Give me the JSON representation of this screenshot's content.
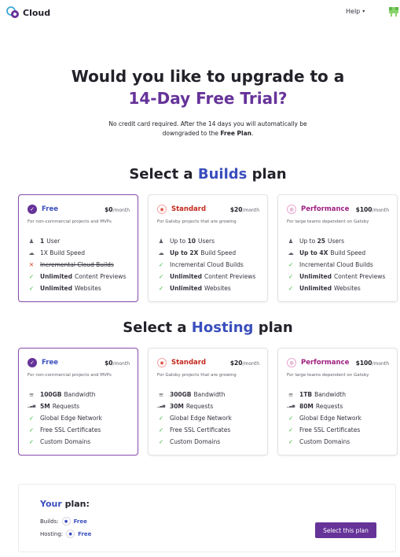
{
  "header": {
    "logo_text": "Cloud",
    "help_label": "Help",
    "help_chevron": "▾"
  },
  "hero": {
    "title": "Would you like to upgrade to a",
    "accent": "14-Day Free Trial?",
    "subtitle_1": "No credit card required. After the 14 days you will automatically be downgraded to the ",
    "subtitle_bold": "Free Plan",
    "subtitle_end": "."
  },
  "builds": {
    "title_pre": "Select a ",
    "title_accent": "Builds",
    "title_post": " plan",
    "plans": [
      {
        "name": "Free",
        "price": "$0",
        "per": "/month",
        "desc": "For non-commercial projects and MVPs",
        "features": [
          {
            "icon": "user-icon",
            "glyph": "♟",
            "bold": "1",
            "text": "User"
          },
          {
            "icon": "cloud-icon",
            "glyph": "☁",
            "bold": "",
            "text": "1X Build Speed"
          },
          {
            "icon": "x-icon",
            "glyph": "✕",
            "bold": "",
            "text": "Incremental Cloud Builds"
          },
          {
            "icon": "check-icon",
            "glyph": "✓",
            "bold": "Unlimited",
            "text": "Content Previews"
          },
          {
            "icon": "check-icon",
            "glyph": "✓",
            "bold": "Unlimited",
            "text": "Websites"
          }
        ]
      },
      {
        "name": "Standard",
        "price": "$20",
        "per": "/month",
        "desc": "For Gatsby projects that are growing",
        "features": [
          {
            "icon": "users-icon",
            "glyph": "♟",
            "bold": "",
            "text": "Up to ",
            "bold2": "10",
            "text2": "Users"
          },
          {
            "icon": "cloud-icon",
            "glyph": "☁",
            "bold": "Up to 2X",
            "text": "Build Speed"
          },
          {
            "icon": "check-icon",
            "glyph": "✓",
            "bold": "",
            "text": "Incremental Cloud Builds"
          },
          {
            "icon": "check-icon",
            "glyph": "✓",
            "bold": "Unlimited",
            "text": "Content Previews"
          },
          {
            "icon": "check-icon",
            "glyph": "✓",
            "bold": "Unlimited",
            "text": "Websites"
          }
        ]
      },
      {
        "name": "Performance",
        "price": "$100",
        "per": "/month",
        "desc": "For large teams dependent on Gatsby",
        "features": [
          {
            "icon": "users-icon",
            "glyph": "♟",
            "bold": "",
            "text": "Up to ",
            "bold2": "25",
            "text2": "Users"
          },
          {
            "icon": "cloud-icon",
            "glyph": "☁",
            "bold": "Up to 4X",
            "text": "Build Speed"
          },
          {
            "icon": "check-icon",
            "glyph": "✓",
            "bold": "",
            "text": "Incremental Cloud Builds"
          },
          {
            "icon": "check-icon",
            "glyph": "✓",
            "bold": "Unlimited",
            "text": "Content Previews"
          },
          {
            "icon": "check-icon",
            "glyph": "✓",
            "bold": "Unlimited",
            "text": "Websites"
          }
        ]
      }
    ]
  },
  "hosting": {
    "title_pre": "Select a ",
    "title_accent": "Hosting",
    "title_post": " plan",
    "plans": [
      {
        "name": "Free",
        "price": "$0",
        "per": "/month",
        "desc": "For non-commercial projects and MVPs",
        "features": [
          {
            "icon": "database-icon",
            "glyph": "≡",
            "bold": "100GB",
            "text": "Bandwidth"
          },
          {
            "icon": "signal-icon",
            "glyph": "▁▃▅",
            "bold": "5M",
            "text": "Requests"
          },
          {
            "icon": "check-icon",
            "glyph": "✓",
            "bold": "",
            "text": "Global Edge Network"
          },
          {
            "icon": "check-icon",
            "glyph": "✓",
            "bold": "",
            "text": "Free SSL Certificates"
          },
          {
            "icon": "check-icon",
            "glyph": "✓",
            "bold": "",
            "text": "Custom Domains"
          }
        ]
      },
      {
        "name": "Standard",
        "price": "$20",
        "per": "/month",
        "desc": "For Gatsby projects that are growing",
        "features": [
          {
            "icon": "database-icon",
            "glyph": "≡",
            "bold": "300GB",
            "text": "Bandwidth"
          },
          {
            "icon": "signal-icon",
            "glyph": "▁▃▅",
            "bold": "30M",
            "text": "Requests"
          },
          {
            "icon": "check-icon",
            "glyph": "✓",
            "bold": "",
            "text": "Global Edge Network"
          },
          {
            "icon": "check-icon",
            "glyph": "✓",
            "bold": "",
            "text": "Free SSL Certificates"
          },
          {
            "icon": "check-icon",
            "glyph": "✓",
            "bold": "",
            "text": "Custom Domains"
          }
        ]
      },
      {
        "name": "Performance",
        "price": "$100",
        "per": "/month",
        "desc": "For large teams dependent on Gatsby",
        "features": [
          {
            "icon": "database-icon",
            "glyph": "≡",
            "bold": "1TB",
            "text": "Bandwidth"
          },
          {
            "icon": "signal-icon",
            "glyph": "▁▃▅",
            "bold": "80M",
            "text": "Requests"
          },
          {
            "icon": "check-icon",
            "glyph": "✓",
            "bold": "",
            "text": "Global Edge Network"
          },
          {
            "icon": "check-icon",
            "glyph": "✓",
            "bold": "",
            "text": "Free SSL Certificates"
          },
          {
            "icon": "check-icon",
            "glyph": "✓",
            "bold": "",
            "text": "Custom Domains"
          }
        ]
      }
    ]
  },
  "your_plan": {
    "title_accent": "Your",
    "title_rest": " plan:",
    "builds_label": "Builds:",
    "builds_value": "Free",
    "hosting_label": "Hosting:",
    "hosting_value": "Free",
    "button_label": "Select this plan"
  },
  "colors": {
    "brand_purple": "#663399",
    "accent_blue": "#3a4fbd",
    "standard_red": "#c4281d",
    "performance_magenta": "#9e1f80",
    "check_green": "#37b635"
  }
}
